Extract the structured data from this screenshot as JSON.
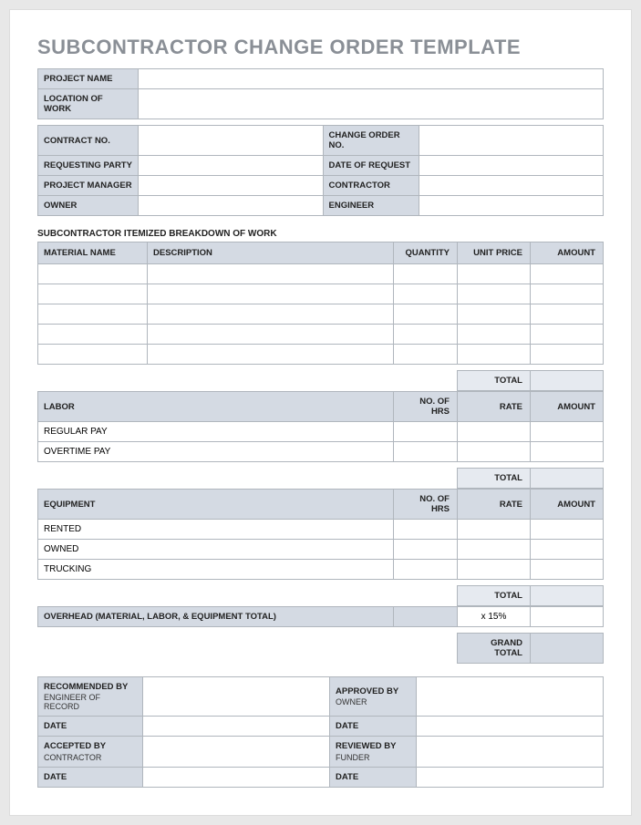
{
  "title": "SUBCONTRACTOR CHANGE ORDER TEMPLATE",
  "projectInfo": {
    "projectName": {
      "label": "PROJECT NAME",
      "value": ""
    },
    "locationOfWork": {
      "label": "LOCATION OF WORK",
      "value": ""
    },
    "contractNo": {
      "label": "CONTRACT NO.",
      "value": ""
    },
    "changeOrderNo": {
      "label": "CHANGE ORDER NO.",
      "value": ""
    },
    "requestingParty": {
      "label": "REQUESTING PARTY",
      "value": ""
    },
    "dateOfRequest": {
      "label": "DATE OF REQUEST",
      "value": ""
    },
    "projectManager": {
      "label": "PROJECT MANAGER",
      "value": ""
    },
    "contractor": {
      "label": "CONTRACTOR",
      "value": ""
    },
    "owner": {
      "label": "OWNER",
      "value": ""
    },
    "engineer": {
      "label": "ENGINEER",
      "value": ""
    }
  },
  "breakdownLabel": "SUBCONTRACTOR ITEMIZED BREAKDOWN OF WORK",
  "materialHeaders": {
    "materialName": "MATERIAL NAME",
    "description": "DESCRIPTION",
    "quantity": "QUANTITY",
    "unitPrice": "UNIT PRICE",
    "amount": "AMOUNT"
  },
  "materialRows": [
    {
      "name": "",
      "desc": "",
      "qty": "",
      "price": "",
      "amount": ""
    },
    {
      "name": "",
      "desc": "",
      "qty": "",
      "price": "",
      "amount": ""
    },
    {
      "name": "",
      "desc": "",
      "qty": "",
      "price": "",
      "amount": ""
    },
    {
      "name": "",
      "desc": "",
      "qty": "",
      "price": "",
      "amount": ""
    },
    {
      "name": "",
      "desc": "",
      "qty": "",
      "price": "",
      "amount": ""
    }
  ],
  "totalLabel": "TOTAL",
  "laborHeaders": {
    "labor": "LABOR",
    "noOfHrs": "NO. OF HRS",
    "rate": "RATE",
    "amount": "AMOUNT"
  },
  "laborRows": [
    {
      "name": "REGULAR PAY",
      "hrs": "",
      "rate": "",
      "amount": ""
    },
    {
      "name": "OVERTIME PAY",
      "hrs": "",
      "rate": "",
      "amount": ""
    }
  ],
  "equipmentHeaders": {
    "equipment": "EQUIPMENT",
    "noOfHrs": "NO. OF HRS",
    "rate": "RATE",
    "amount": "AMOUNT"
  },
  "equipmentRows": [
    {
      "name": "RENTED",
      "hrs": "",
      "rate": "",
      "amount": ""
    },
    {
      "name": "OWNED",
      "hrs": "",
      "rate": "",
      "amount": ""
    },
    {
      "name": "TRUCKING",
      "hrs": "",
      "rate": "",
      "amount": ""
    }
  ],
  "overhead": {
    "label": "OVERHEAD (MATERIAL, LABOR, & EQUIPMENT TOTAL)",
    "pct": "x 15%",
    "value": ""
  },
  "grandTotal": {
    "label": "GRAND TOTAL",
    "value": ""
  },
  "signatures": {
    "recommended": {
      "label": "RECOMMENDED BY",
      "sub": "ENGINEER OF RECORD",
      "value": ""
    },
    "approved": {
      "label": "APPROVED BY",
      "sub": "OWNER",
      "value": ""
    },
    "accepted": {
      "label": "ACCEPTED BY",
      "sub": "CONTRACTOR",
      "value": ""
    },
    "reviewed": {
      "label": "REVIEWED BY",
      "sub": "FUNDER",
      "value": ""
    },
    "dateLabel": "DATE",
    "date1": "",
    "date2": "",
    "date3": "",
    "date4": ""
  }
}
